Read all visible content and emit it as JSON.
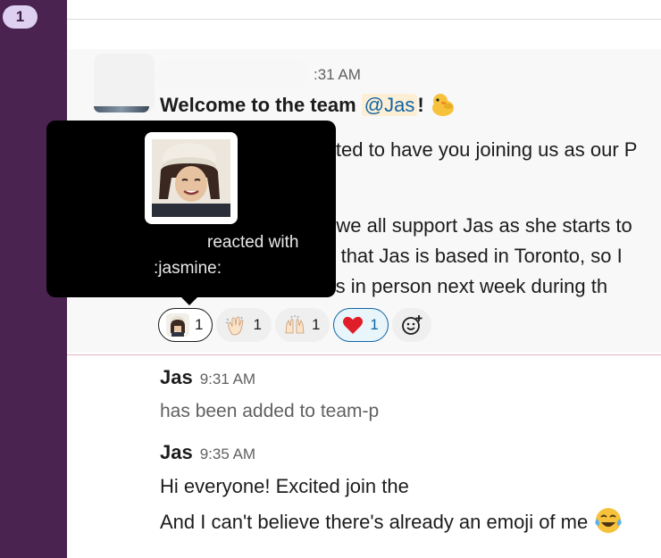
{
  "workspace": {
    "badge": "1"
  },
  "message": {
    "time": ":31 AM",
    "title_prefix": "Welcome to the team ",
    "mention": "@Jas",
    "title_suffix": "!",
    "lines": [
      "cited to have you joining us as our P",
      "e we all support Jas as she starts to",
      "nd that Jas is based in Toronto, so I",
      "g us in person next week during th"
    ]
  },
  "tooltip": {
    "reacted_with": "reacted with",
    "emoji_name": ":jasmine:"
  },
  "reactions": [
    {
      "emoji": "jasmine-custom-emoji",
      "count": "1",
      "state": "mine"
    },
    {
      "emoji": "waving-hand-icon",
      "count": "1",
      "state": "normal"
    },
    {
      "emoji": "raising-hands-icon",
      "count": "1",
      "state": "normal"
    },
    {
      "emoji": "red-heart-icon",
      "count": "1",
      "state": "selected"
    }
  ],
  "messages": [
    {
      "sender": "Jas",
      "time": "9:31 AM",
      "body": "has been added to team-p"
    },
    {
      "sender": "Jas",
      "time": "9:35 AM",
      "lines": [
        "Hi everyone! Excited join the",
        "And I can't believe there's already an emoji of me"
      ]
    }
  ],
  "colors": {
    "sidebar": "#4a2350",
    "accent": "#1264a3",
    "heart": "#e01e5a",
    "new_divider": "#e8b2c2"
  }
}
